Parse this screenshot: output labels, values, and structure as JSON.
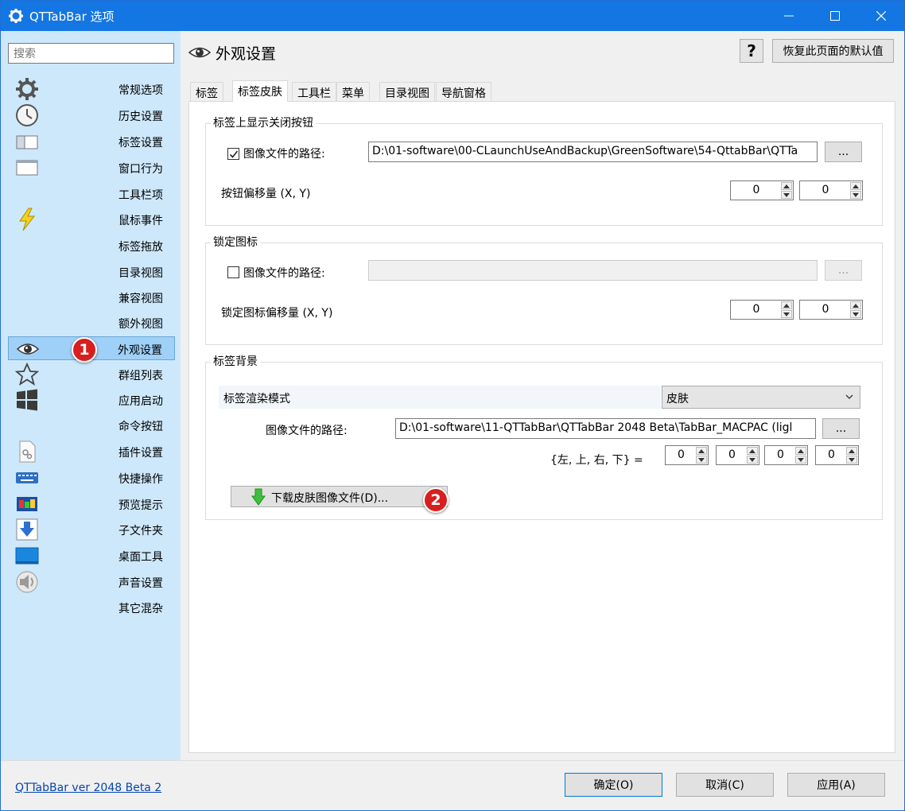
{
  "window": {
    "title": "QTTabBar 选项",
    "minimize_glyph": "—",
    "maximize_glyph": "☐",
    "close_glyph": "✕"
  },
  "sidebar": {
    "search_placeholder": "搜索",
    "items": [
      {
        "label": "常规选项",
        "icon": "gear-icon"
      },
      {
        "label": "历史设置",
        "icon": "clock-icon"
      },
      {
        "label": "标签设置",
        "icon": "tabs-icon"
      },
      {
        "label": "窗口行为",
        "icon": "window-icon"
      },
      {
        "label": "工具栏项",
        "icon": ""
      },
      {
        "label": "鼠标事件",
        "icon": "lightning-icon"
      },
      {
        "label": "标签拖放",
        "icon": ""
      },
      {
        "label": "目录视图",
        "icon": ""
      },
      {
        "label": "兼容视图",
        "icon": ""
      },
      {
        "label": "额外视图",
        "icon": ""
      },
      {
        "label": "外观设置",
        "icon": "eye-icon",
        "selected": true
      },
      {
        "label": "群组列表",
        "icon": "star-icon"
      },
      {
        "label": "应用启动",
        "icon": "windows-logo-icon"
      },
      {
        "label": "命令按钮",
        "icon": ""
      },
      {
        "label": "插件设置",
        "icon": "plugin-icon"
      },
      {
        "label": "快捷操作",
        "icon": "keyboard-icon"
      },
      {
        "label": "预览提示",
        "icon": "preview-icon"
      },
      {
        "label": "子文件夹",
        "icon": "download-arrow-icon"
      },
      {
        "label": "桌面工具",
        "icon": "desktop-icon"
      },
      {
        "label": "声音设置",
        "icon": "speaker-icon"
      },
      {
        "label": "其它混杂",
        "icon": ""
      }
    ]
  },
  "annotations": {
    "badge1": "1",
    "badge2": "2"
  },
  "header": {
    "title": "外观设置",
    "help_glyph": "?",
    "reset_label": "恢复此页面的默认值"
  },
  "tabs": [
    {
      "label": "标签"
    },
    {
      "label": "标签皮肤",
      "active": true
    },
    {
      "label": "工具栏"
    },
    {
      "label": "菜单"
    },
    {
      "label": "目录视图"
    },
    {
      "label": "导航窗格"
    }
  ],
  "close_button_group": {
    "title": "标签上显示关闭按钮",
    "image_path_label": "图像文件的路径:",
    "image_path_checked": true,
    "image_path_value": "D:\\01-software\\00-CLaunchUseAndBackup\\GreenSoftware\\54-QttabBar\\QTTa",
    "browse_label": "...",
    "offset_label": "按钮偏移量 (X, Y)",
    "offset_x": "0",
    "offset_y": "0"
  },
  "lock_icon_group": {
    "title": "锁定图标",
    "image_path_label": "图像文件的路径:",
    "image_path_checked": false,
    "image_path_value": "",
    "browse_label": "...",
    "offset_label": "锁定图标偏移量 (X, Y)",
    "offset_x": "0",
    "offset_y": "0"
  },
  "tab_background_group": {
    "title": "标签背景",
    "render_mode_label": "标签渲染模式",
    "render_mode_value": "皮肤",
    "image_path_label": "图像文件的路径:",
    "image_path_value": "D:\\01-software\\11-QTTabBar\\QTTabBar 2048 Beta\\TabBar_MACPAC (ligl",
    "browse_label": "...",
    "margins_label": "{左, 上, 右, 下} =",
    "margins": [
      "0",
      "0",
      "0",
      "0"
    ],
    "download_label": "下载皮肤图像文件(D)..."
  },
  "footer": {
    "version_link": "QTTabBar ver 2048 Beta 2",
    "ok_label": "确定(O)",
    "cancel_label": "取消(C)",
    "apply_label": "应用(A)"
  }
}
